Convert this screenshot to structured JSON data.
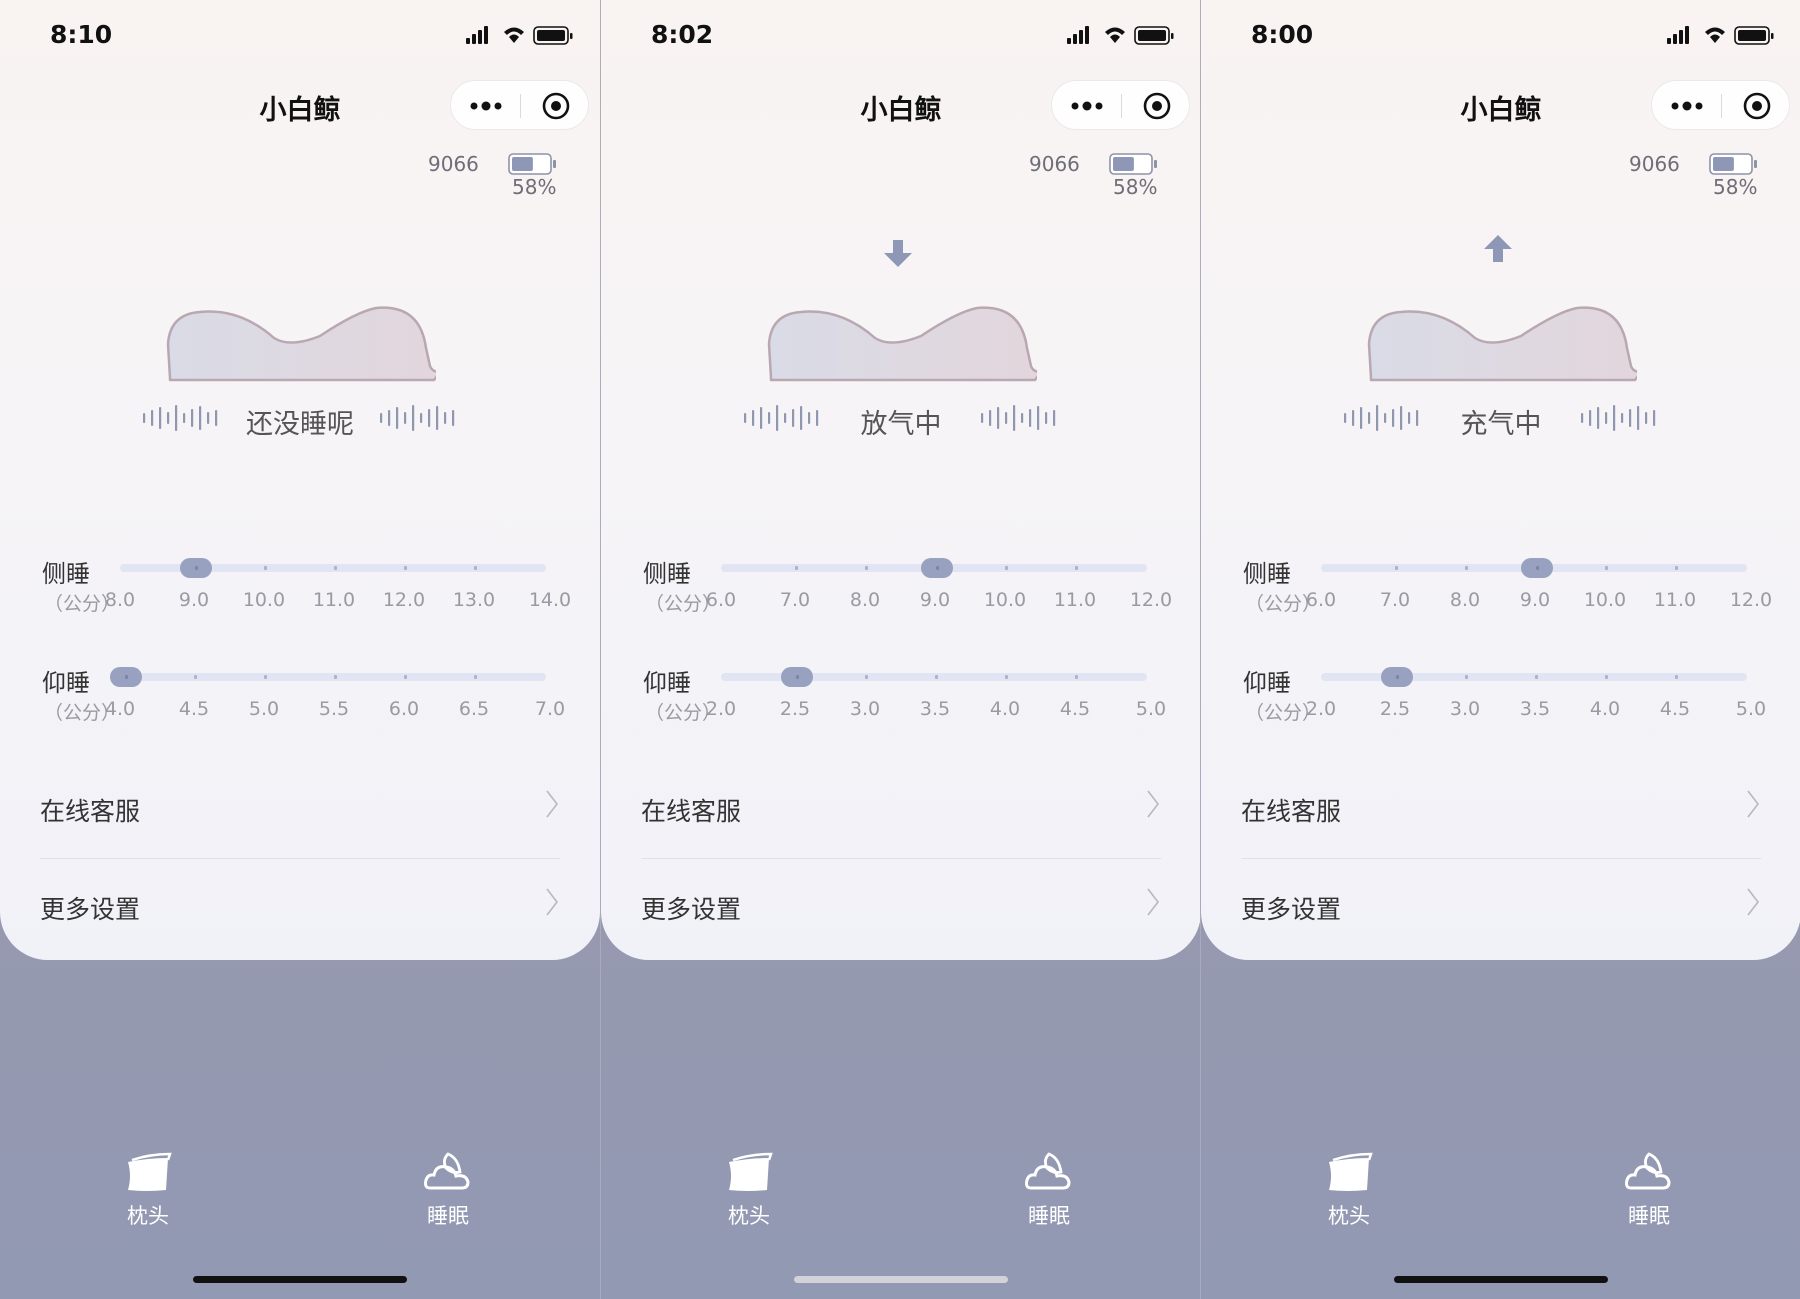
{
  "app_title": "小白鲸",
  "device": {
    "id": "9066",
    "battery": "58%",
    "battery_level": 0.58
  },
  "colors": {
    "accent": "#98a1bf",
    "track": "#e1e4f2",
    "card_bg": "#f4f2f7",
    "bottom_bg": "#9899ad"
  },
  "screens": [
    {
      "time": "8:10",
      "status": "还没睡呢",
      "arrow": "none",
      "side_sleep": {
        "label": "侧睡",
        "unit": "（公分）",
        "ticks": [
          "8.0",
          "9.0",
          "10.0",
          "11.0",
          "12.0",
          "13.0",
          "14.0"
        ],
        "value": "9.0"
      },
      "back_sleep": {
        "label": "仰睡",
        "unit": "（公分）",
        "ticks": [
          "4.0",
          "4.5",
          "5.0",
          "5.5",
          "6.0",
          "6.5",
          "7.0"
        ],
        "value": "4.0"
      },
      "home_indicator": "dark"
    },
    {
      "time": "8:02",
      "status": "放气中",
      "arrow": "down",
      "side_sleep": {
        "label": "侧睡",
        "unit": "（公分）",
        "ticks": [
          "6.0",
          "7.0",
          "8.0",
          "9.0",
          "10.0",
          "11.0",
          "12.0"
        ],
        "value": "9.0"
      },
      "back_sleep": {
        "label": "仰睡",
        "unit": "（公分）",
        "ticks": [
          "2.0",
          "2.5",
          "3.0",
          "3.5",
          "4.0",
          "4.5",
          "5.0"
        ],
        "value": "2.5"
      },
      "home_indicator": "light"
    },
    {
      "time": "8:00",
      "status": "充气中",
      "arrow": "up",
      "side_sleep": {
        "label": "侧睡",
        "unit": "（公分）",
        "ticks": [
          "6.0",
          "7.0",
          "8.0",
          "9.0",
          "10.0",
          "11.0",
          "12.0"
        ],
        "value": "9.0"
      },
      "back_sleep": {
        "label": "仰睡",
        "unit": "（公分）",
        "ticks": [
          "2.0",
          "2.5",
          "3.0",
          "3.5",
          "4.0",
          "4.5",
          "5.0"
        ],
        "value": "2.5"
      },
      "home_indicator": "dark"
    }
  ],
  "menu": {
    "customer_service": "在线客服",
    "more_settings": "更多设置"
  },
  "tabs": [
    {
      "label": "枕头",
      "icon": "pillow-icon"
    },
    {
      "label": "睡眠",
      "icon": "moon-cloud-icon"
    }
  ]
}
